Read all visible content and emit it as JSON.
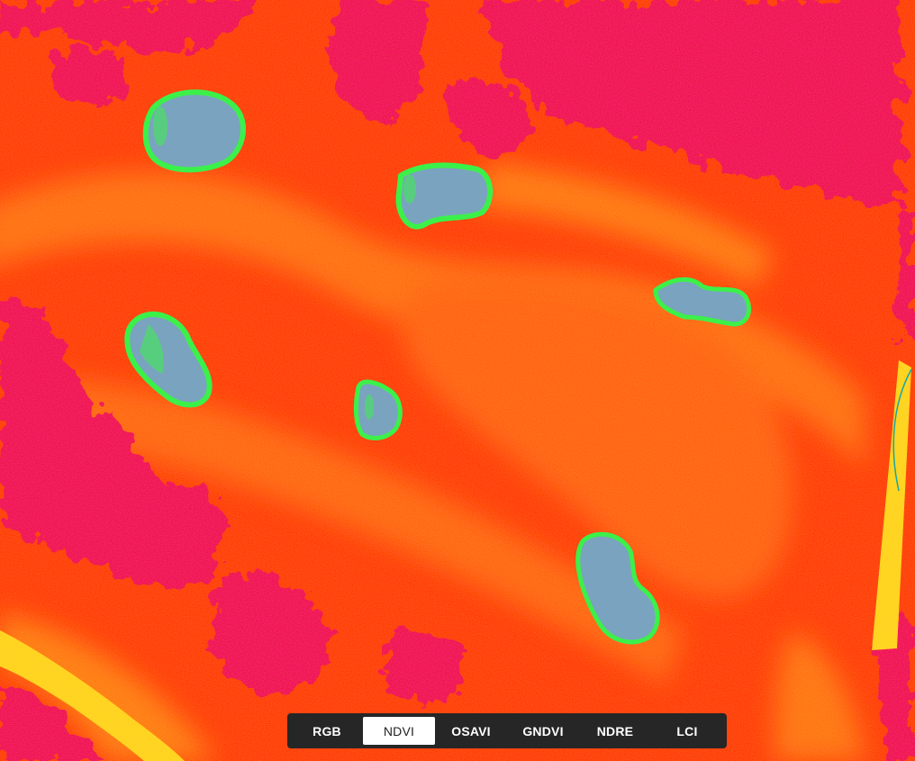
{
  "map": {
    "view": "NDVI",
    "colors": {
      "low_vegetation": "#ff3a0a",
      "canopy": "#f0115a",
      "high_vigor": "#ffd21e",
      "water": "#7aa3bf",
      "water_edge": "#3cf04a"
    }
  },
  "toolbar": {
    "active": "NDVI",
    "buttons": [
      {
        "label": "RGB"
      },
      {
        "label": "NDVI"
      },
      {
        "label": "OSAVI"
      },
      {
        "label": "GNDVI"
      },
      {
        "label": "NDRE"
      },
      {
        "label": "LCI"
      }
    ]
  }
}
